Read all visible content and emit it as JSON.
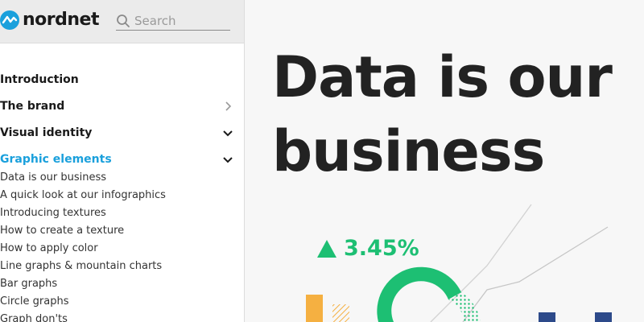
{
  "brand": {
    "name": "nordnet",
    "logo_icon": "nordnet-logo-icon"
  },
  "search": {
    "placeholder": "Search",
    "icon": "search-icon"
  },
  "nav": {
    "items": [
      {
        "label": "Introduction",
        "chevron": "none"
      },
      {
        "label": "The brand",
        "chevron": "right"
      },
      {
        "label": "Visual identity",
        "chevron": "down"
      },
      {
        "label": "Graphic elements",
        "chevron": "down",
        "active": true
      }
    ],
    "sub_items": [
      "Data is our business",
      "A quick look at our infographics",
      "Introducing textures",
      "How to create a texture",
      "How to apply color",
      "Line graphs & mountain charts",
      "Bar graphs",
      "Circle graphs",
      "Graph don'ts"
    ]
  },
  "main": {
    "title_line1": "Data is our",
    "title_line2": "business",
    "stat": {
      "value": "3.45%",
      "direction_icon": "triangle-up-icon",
      "color": "#1dbf73"
    }
  },
  "colors": {
    "accent": "#1aa0dc",
    "green": "#1dbf73",
    "orange": "#f5b041",
    "navy": "#2d4a8a"
  }
}
